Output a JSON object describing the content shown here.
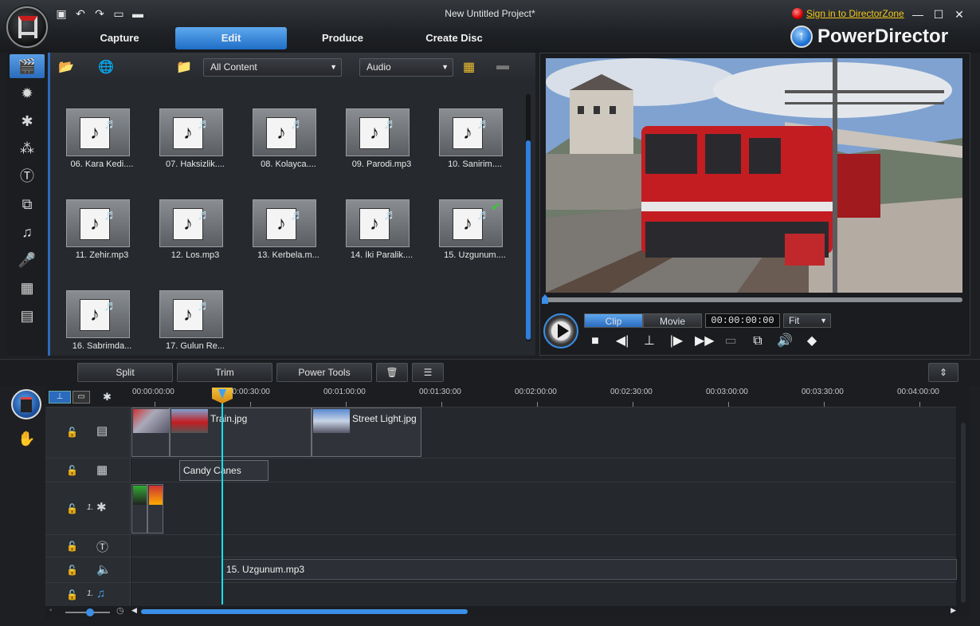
{
  "window": {
    "title": "New Untitled Project*",
    "sign_in": "Sign in to DirectorZone",
    "brand": "PowerDirector"
  },
  "tabs": [
    {
      "label": "Capture"
    },
    {
      "label": "Edit"
    },
    {
      "label": "Produce"
    },
    {
      "label": "Create Disc"
    }
  ],
  "library": {
    "filter": "All Content",
    "type": "Audio",
    "items": [
      {
        "label": "06. Kara Kedi...."
      },
      {
        "label": "07. Haksizlik...."
      },
      {
        "label": "08. Kolayca...."
      },
      {
        "label": "09. Parodi.mp3"
      },
      {
        "label": "10. Sanirim...."
      },
      {
        "label": "11. Zehir.mp3"
      },
      {
        "label": "12. Los.mp3"
      },
      {
        "label": "13. Kerbela.m..."
      },
      {
        "label": "14. İki Paralik...."
      },
      {
        "label": "15. Uzgunum...."
      },
      {
        "label": "16. Sabrimda..."
      },
      {
        "label": "17. Gulun Re..."
      }
    ]
  },
  "preview": {
    "mode_clip": "Clip",
    "mode_movie": "Movie",
    "timecode": "00:00:00:00",
    "fit": "Fit"
  },
  "timeline_tools": {
    "split": "Split",
    "trim": "Trim",
    "power_tools": "Power Tools"
  },
  "ruler": [
    "00:00:00:00",
    "00:00:30:00",
    "00:01:00:00",
    "00:01:30:00",
    "00:02:00:00",
    "00:02:30:00",
    "00:03:00:00",
    "00:03:30:00",
    "00:04:00:00"
  ],
  "tracks": {
    "video_clips": [
      "Train.jpg",
      "Street Light.jpg"
    ],
    "pip_clip": "Candy Canes",
    "fx_num": "1.",
    "music_num": "1.",
    "audio_clip": "15. Uzgunum.mp3"
  }
}
